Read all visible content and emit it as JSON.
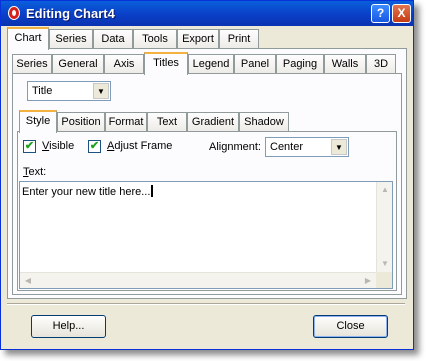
{
  "window": {
    "title": "Editing Chart4",
    "help_glyph": "?",
    "close_glyph": "X"
  },
  "main_tabs": [
    "Chart",
    "Series",
    "Data",
    "Tools",
    "Export",
    "Print"
  ],
  "chart_tabs": [
    "Series",
    "General",
    "Axis",
    "Titles",
    "Legend",
    "Panel",
    "Paging",
    "Walls",
    "3D"
  ],
  "title_selector": {
    "value": "Title"
  },
  "title_tabs": [
    "Style",
    "Position",
    "Format",
    "Text",
    "Gradient",
    "Shadow"
  ],
  "style": {
    "visible_label": "Visible",
    "visible_checked": true,
    "adjust_frame_label": "Adjust Frame",
    "adjust_frame_checked": true,
    "alignment_label": "Alignment:",
    "alignment_value": "Center",
    "text_label": "Text:",
    "text_value": "Enter your new title here..."
  },
  "buttons": {
    "help": "Help...",
    "close": "Close"
  },
  "glyphs": {
    "check": "✔",
    "down": "▼",
    "up": "▲",
    "left": "◀",
    "right": "▶"
  }
}
